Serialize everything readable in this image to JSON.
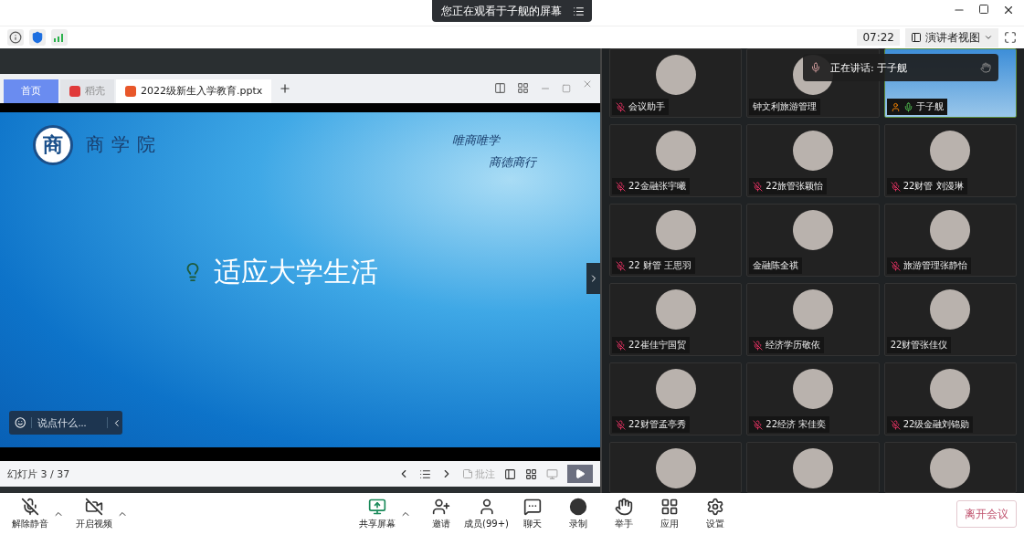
{
  "banner": {
    "text": "您正在观看于子舰的屏幕"
  },
  "info_bar": {
    "timer": "07:22",
    "view_button": "演讲者视图"
  },
  "shared_screen": {
    "tabs": [
      {
        "label": "首页",
        "kind": "home",
        "selected": false
      },
      {
        "label": "稻壳",
        "kind": "app",
        "selected": false
      },
      {
        "label": "2022级新生入学教育.pptx",
        "kind": "doc",
        "selected": true
      }
    ],
    "slide": {
      "logo_char": "商",
      "school": "商学院",
      "motto": [
        "唯商唯学",
        "商德商行"
      ],
      "title": "适应大学生活"
    },
    "chat_box": {
      "placeholder": "说点什么..."
    },
    "status": {
      "slide_count": "幻灯片 3 / 37",
      "note_button": "批注"
    }
  },
  "speaking_toast": {
    "text": "正在讲话: 于子舰"
  },
  "participants": [
    {
      "name": "会议助手",
      "muted": true,
      "speaking": false,
      "video": false
    },
    {
      "name": "钟文利旅游管理",
      "muted": false,
      "speaking": false,
      "video": false
    },
    {
      "name": "于子舰",
      "muted": false,
      "speaking": true,
      "video": true
    },
    {
      "name": "22金融张宇曦",
      "muted": true,
      "speaking": false,
      "video": false
    },
    {
      "name": "22旅管张颖怡",
      "muted": true,
      "speaking": false,
      "video": false
    },
    {
      "name": "22财管 刘漫琳",
      "muted": true,
      "speaking": false,
      "video": false
    },
    {
      "name": "22 财管 王思羽",
      "muted": true,
      "speaking": false,
      "video": false
    },
    {
      "name": "金融陈全祺",
      "muted": false,
      "speaking": false,
      "video": false
    },
    {
      "name": "旅游管理张静怡",
      "muted": true,
      "speaking": false,
      "video": false
    },
    {
      "name": "22崔佳宁国贸",
      "muted": true,
      "speaking": false,
      "video": false
    },
    {
      "name": "经济学历敬依",
      "muted": true,
      "speaking": false,
      "video": false
    },
    {
      "name": "22财管张佳仪",
      "muted": false,
      "speaking": false,
      "video": false
    },
    {
      "name": "22财管孟亭秀",
      "muted": true,
      "speaking": false,
      "video": false
    },
    {
      "name": "22经济 宋佳奕",
      "muted": true,
      "speaking": false,
      "video": false
    },
    {
      "name": "22级金融刘锦勋",
      "muted": true,
      "speaking": false,
      "video": false
    },
    {
      "video": false
    },
    {
      "video": false
    },
    {
      "video": false
    }
  ],
  "toolbar": {
    "left": [
      {
        "label": "解除静音",
        "kind": "mic",
        "off": true
      },
      {
        "label": "开启视频",
        "kind": "camera",
        "off": true
      }
    ],
    "center": [
      {
        "label": "共享屏幕",
        "kind": "share"
      },
      {
        "label": "邀请",
        "kind": "invite"
      },
      {
        "label": "成员(99+)",
        "kind": "members"
      },
      {
        "label": "聊天",
        "kind": "chat"
      },
      {
        "label": "录制",
        "kind": "record"
      },
      {
        "label": "举手",
        "kind": "hand"
      },
      {
        "label": "应用",
        "kind": "apps"
      },
      {
        "label": "设置",
        "kind": "settings"
      }
    ],
    "leave_button": "离开会议"
  }
}
